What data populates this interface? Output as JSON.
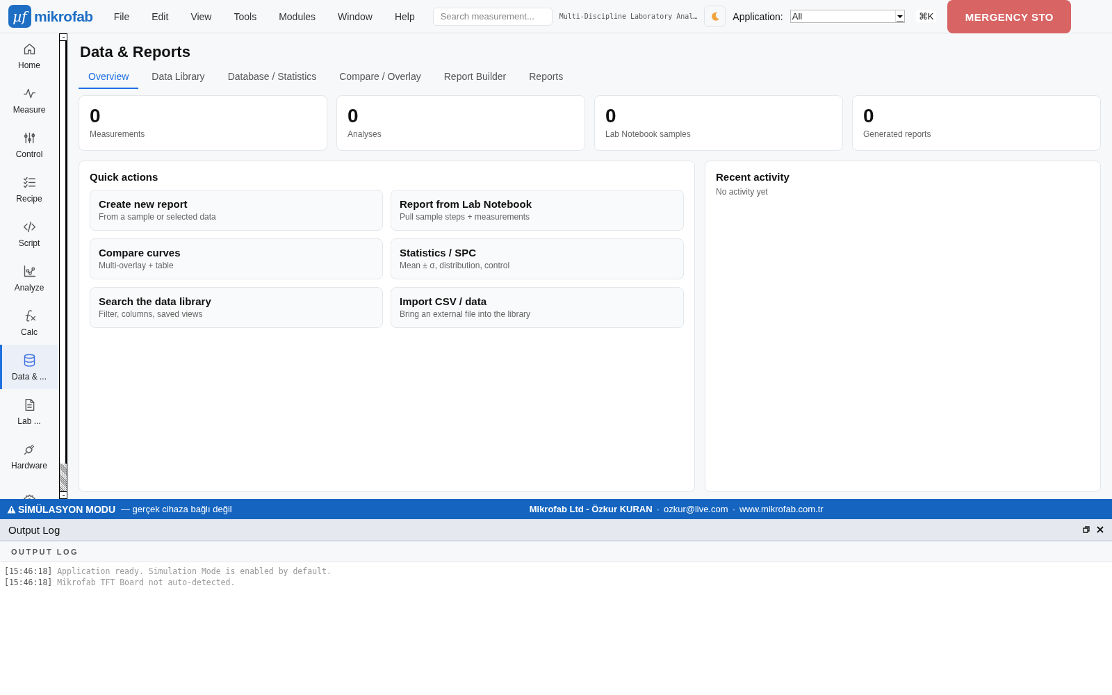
{
  "app": {
    "logo_mark": "µf",
    "logo_text": "mikrofab"
  },
  "menu": [
    "File",
    "Edit",
    "View",
    "Tools",
    "Modules",
    "Window",
    "Help"
  ],
  "search": {
    "placeholder": "Search measurement..."
  },
  "window_title": "Multi-Discipline Laboratory Anal…",
  "application": {
    "label": "Application:",
    "value": "All"
  },
  "shortcut": "⌘K",
  "emergency_button": "MERGENCY STO",
  "sidebar": [
    {
      "label": "Home",
      "selected": false
    },
    {
      "label": "Measure",
      "selected": false
    },
    {
      "label": "Control",
      "selected": false
    },
    {
      "label": "Recipe",
      "selected": false
    },
    {
      "label": "Script",
      "selected": false
    },
    {
      "label": "Analyze",
      "selected": false
    },
    {
      "label": "Calc",
      "selected": false
    },
    {
      "label": "Data & ...",
      "selected": true
    },
    {
      "label": "Lab ...",
      "selected": false
    },
    {
      "label": "Hardware",
      "selected": false
    },
    {
      "selected": false
    }
  ],
  "page": {
    "title": "Data & Reports",
    "tabs": [
      {
        "label": "Overview",
        "selected": true
      },
      {
        "label": "Data Library",
        "selected": false
      },
      {
        "label": "Database / Statistics",
        "selected": false
      },
      {
        "label": "Compare / Overlay",
        "selected": false
      },
      {
        "label": "Report Builder",
        "selected": false
      },
      {
        "label": "Reports",
        "selected": false
      }
    ],
    "stats": [
      {
        "value": "0",
        "label": "Measurements"
      },
      {
        "value": "0",
        "label": "Analyses"
      },
      {
        "value": "0",
        "label": "Lab Notebook samples"
      },
      {
        "value": "0",
        "label": "Generated reports"
      }
    ],
    "quick_actions": {
      "title": "Quick actions",
      "items": [
        {
          "title": "Create new report",
          "subtitle": "From a sample or selected data"
        },
        {
          "title": "Report from Lab Notebook",
          "subtitle": "Pull sample steps + measurements"
        },
        {
          "title": "Compare curves",
          "subtitle": "Multi-overlay + table"
        },
        {
          "title": "Statistics / SPC",
          "subtitle": "Mean ± σ, distribution, control"
        },
        {
          "title": "Search the data library",
          "subtitle": "Filter, columns, saved views"
        },
        {
          "title": "Import CSV / data",
          "subtitle": "Bring an external file into the library"
        }
      ]
    },
    "recent_activity": {
      "title": "Recent activity",
      "empty": "No activity yet"
    }
  },
  "status_bar": {
    "mode": "SİMÜLASYON MODU",
    "mode_note": "— gerçek cihaza bağlı değil",
    "company": "Mikrofab Ltd - Özkur KURAN",
    "email": "ozkur@live.com",
    "website": "www.mikrofab.com.tr",
    "separator": "·"
  },
  "output_log": {
    "title": "Output Log",
    "section": "OUTPUT LOG",
    "lines": [
      {
        "time": "[15:46:18]",
        "message": "Application ready. Simulation Mode is enabled by default."
      },
      {
        "time": "[15:46:18]",
        "message": "Mikrofab TFT Board not auto-detected."
      }
    ]
  }
}
